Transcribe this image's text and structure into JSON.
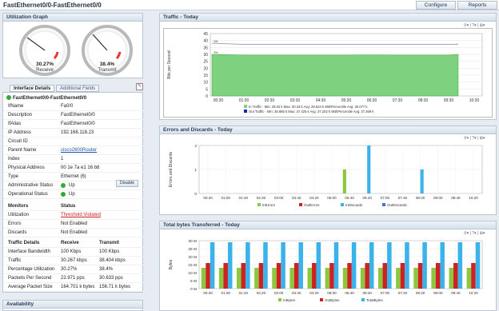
{
  "header": {
    "title": "FastEthernet0/0-FastEthernet0/0",
    "configure": "Configure",
    "reports": "Reports"
  },
  "util": {
    "title": "Utilization Graph",
    "receive_value": "30.27%",
    "receive_label": "Receive",
    "transmit_value": "38.4%",
    "transmit_label": "Transmit"
  },
  "tabs": {
    "details": "Interface Details",
    "additional": "Additional Fields"
  },
  "iface": {
    "name": "FastEthernet0/0-FastEthernet0/0",
    "rows": [
      [
        "IfName",
        "Fa0/0"
      ],
      [
        "Description",
        "FastEthernet0/0"
      ],
      [
        "IfAlias",
        "FastEthernet0/0"
      ],
      [
        "IP Address",
        "192.168.118.23"
      ],
      [
        "Circuit ID",
        ""
      ],
      [
        "Parent Name",
        "cisco2600Router"
      ],
      [
        "Index",
        "1"
      ],
      [
        "Physical Address",
        "00 1e 7a e1 16 b8"
      ],
      [
        "Type",
        "Ethernet (6)"
      ],
      [
        "Administrative Status",
        "Up"
      ],
      [
        "Operational Status",
        "Up"
      ]
    ],
    "disable": "Disable"
  },
  "monitors": {
    "h1": "Monitors",
    "h2": "Status",
    "rows": [
      [
        "Utilization",
        "Threshold Violated"
      ],
      [
        "Errors",
        "Not Enabled"
      ],
      [
        "Discards",
        "Not Enabled"
      ]
    ]
  },
  "traffic": {
    "h1": "Traffic Details",
    "h2": "Receive",
    "h3": "Transmit",
    "rows": [
      [
        "Interface Bandwidth",
        "100 Kbps",
        "100 Kbps"
      ],
      [
        "Traffic",
        "30.267 kbps",
        "38.404 kbps"
      ],
      [
        "Percentage Utilization",
        "30.27%",
        "38.4%"
      ],
      [
        "Packets Per Second",
        "22.971 pps",
        "30.633 pps"
      ],
      [
        "Average Packet Size",
        "164.701 k bytes",
        "156.71 k bytes"
      ]
    ]
  },
  "availability": {
    "title": "Availability"
  },
  "chart1": {
    "title": "Traffic - Today",
    "ylabel": "Bits per Second",
    "yticks": [
      "45",
      "40",
      "35",
      "30",
      "25",
      "20",
      "15",
      "10",
      "5",
      "0"
    ],
    "xticks": [
      "00:30",
      "01:30",
      "02:30",
      "03:30",
      "04:30",
      "05:30",
      "06:30",
      "07:30",
      "08:30",
      "09:30",
      "10:30"
    ],
    "legend_in": "In Traffic - Min: 29.02 k  Max: 30.33 k  Avg: 29.524 k  95thPercentile Avg: 30.077 k",
    "legend_out": "Out Traffic - Min: 36.985 k  Max: 37.425 k  Avg: 37.202 k  95thPercentile Avg: 37.369 k",
    "marker_out": "38k",
    "marker_in": "30k"
  },
  "chart2": {
    "title": "Errors and Discards - Today",
    "ylabel": "Errors and Discards",
    "yticks": [
      "2",
      "1",
      "0"
    ],
    "xticks": [
      "00:20",
      "01:00",
      "01:40",
      "02:20",
      "03:00",
      "03:40",
      "04:20",
      "05:00",
      "05:40",
      "06:20",
      "07:00",
      "07:40",
      "08:20",
      "09:00",
      "09:40",
      "10:20"
    ],
    "legend": [
      "InErrors",
      "OutErrors",
      "InDiscards",
      "OutDiscards"
    ]
  },
  "chart3": {
    "title": "Total bytes Transferred - Today",
    "ylabel": "Bytes",
    "yticks": [
      "30 M",
      "25 M",
      "20 M",
      "15 M",
      "10 M",
      "5 M",
      "0 M"
    ],
    "xticks": [
      "00:20",
      "01:00",
      "01:40",
      "02:20",
      "03:00",
      "03:40",
      "04:20",
      "05:00",
      "05:40",
      "06:20",
      "07:00",
      "07:40",
      "08:20",
      "09:00",
      "09:40",
      "10:20"
    ],
    "legend": [
      "InBytes",
      "OutBytes",
      "TotalBytes"
    ]
  },
  "colors": {
    "in": "#8dc63f",
    "out": "#cc2222",
    "total": "#3bb3ea",
    "discard": "#3bb3ea",
    "traffic": "#7ed17e",
    "error_green": "#8dc63f"
  },
  "chart_data": [
    {
      "type": "area",
      "title": "Traffic - Today",
      "ylabel": "Bits per Second",
      "ylim": [
        0,
        45
      ],
      "x": [
        "00:30",
        "01:30",
        "02:30",
        "03:30",
        "04:30",
        "05:30",
        "06:30",
        "07:30",
        "08:30",
        "09:30",
        "10:30"
      ],
      "series": [
        {
          "name": "In Traffic",
          "values": [
            30,
            29.5,
            29.5,
            29.5,
            29.5,
            29.5,
            29.6,
            29.5,
            29.5,
            29.5,
            30
          ]
        },
        {
          "name": "Out Traffic",
          "values": [
            38,
            37.2,
            37.2,
            37.2,
            37.2,
            37.2,
            37.2,
            37.2,
            37.2,
            37.2,
            37.4
          ]
        }
      ]
    },
    {
      "type": "bar",
      "title": "Errors and Discards - Today",
      "ylabel": "Errors and Discards",
      "ylim": [
        0,
        2
      ],
      "categories": [
        "00:20",
        "01:00",
        "01:40",
        "02:20",
        "03:00",
        "03:40",
        "04:20",
        "05:00",
        "05:40",
        "06:20",
        "07:00",
        "07:40",
        "08:20",
        "09:00",
        "09:40",
        "10:20"
      ],
      "series": [
        {
          "name": "InErrors",
          "values": [
            0,
            0,
            0,
            0,
            0,
            0,
            0,
            0,
            1,
            0,
            0,
            0,
            0,
            0,
            0,
            0
          ]
        },
        {
          "name": "OutErrors",
          "values": [
            0,
            0,
            0,
            0,
            0,
            0,
            0,
            0,
            0,
            0,
            0,
            0,
            0,
            0,
            0,
            0
          ]
        },
        {
          "name": "InDiscards",
          "values": [
            0,
            0,
            0,
            0,
            0,
            0,
            0,
            0,
            0,
            2,
            0,
            0,
            1,
            0,
            0,
            0
          ]
        },
        {
          "name": "OutDiscards",
          "values": [
            0,
            0,
            0,
            0,
            0,
            0,
            0,
            0,
            0,
            0,
            0,
            0,
            0,
            0,
            0,
            0
          ]
        }
      ]
    },
    {
      "type": "bar",
      "title": "Total bytes Transferred - Today",
      "ylabel": "Bytes",
      "ylim": [
        0,
        30
      ],
      "categories": [
        "00:20",
        "01:00",
        "01:40",
        "02:20",
        "03:00",
        "03:40",
        "04:20",
        "05:00",
        "05:40",
        "06:20",
        "07:00",
        "07:40",
        "08:20",
        "09:00",
        "09:40",
        "10:20"
      ],
      "series": [
        {
          "name": "InBytes",
          "values": [
            13,
            13,
            13,
            13,
            13,
            13,
            13,
            13,
            13,
            13,
            13,
            13,
            13,
            13,
            13,
            13
          ]
        },
        {
          "name": "OutBytes",
          "values": [
            16,
            16,
            16,
            16,
            16,
            16,
            16,
            16,
            16,
            16,
            16,
            16,
            16,
            16,
            16,
            16
          ]
        },
        {
          "name": "TotalBytes",
          "values": [
            29,
            29,
            29,
            29,
            29,
            29,
            29,
            29,
            29,
            29,
            29,
            29,
            29,
            29,
            29,
            29
          ]
        }
      ]
    }
  ]
}
